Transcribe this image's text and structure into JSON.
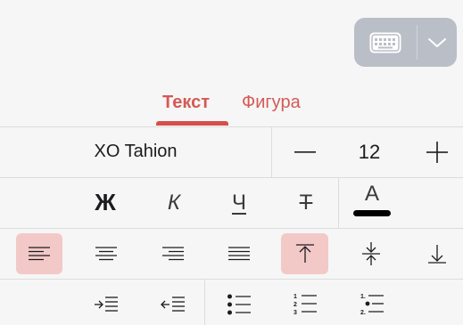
{
  "tabs": [
    {
      "label": "Текст",
      "active": true
    },
    {
      "label": "Фигура",
      "active": false
    }
  ],
  "font": {
    "name": "XO Tahion"
  },
  "size": {
    "value": "12",
    "minus": "—",
    "plus": "+"
  },
  "style": {
    "bold": "Ж",
    "italic": "К",
    "underline": "Ч",
    "strike": "Т",
    "color_letter": "А"
  },
  "colors": {
    "accent": "#d45a55",
    "selected_bg": "#f3c9c8",
    "text_color_bar": "#000000"
  },
  "icons": [
    "keyboard-icon",
    "chevron-down-icon",
    "align-left-icon",
    "align-center-icon",
    "align-right-icon",
    "align-justify-icon",
    "valign-top-icon",
    "valign-middle-icon",
    "valign-bottom-icon",
    "indent-increase-icon",
    "indent-decrease-icon",
    "bullet-list-icon",
    "numbered-list-icon",
    "multilevel-list-icon"
  ]
}
